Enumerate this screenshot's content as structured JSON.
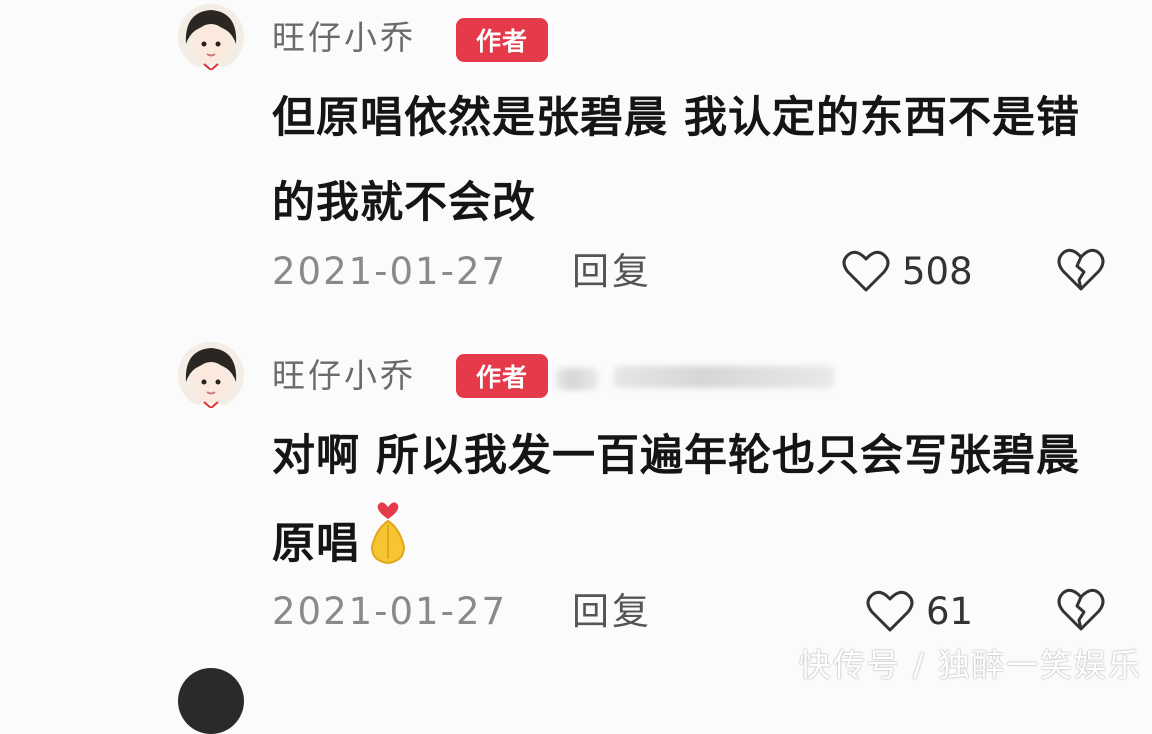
{
  "comments": [
    {
      "username": "旺仔小乔",
      "badge": "作者",
      "content": "但原唱依然是张碧晨 我认定的东西不是错的我就不会改",
      "date": "2021-01-27",
      "reply_label": "回复",
      "likes": "508"
    },
    {
      "username": "旺仔小乔",
      "badge": "作者",
      "content": "对啊 所以我发一百遍年轮也只会写张碧晨原唱",
      "emoji": "pray-hands-emoji",
      "date": "2021-01-27",
      "reply_label": "回复",
      "likes": "61"
    }
  ],
  "watermark": "快传号 / 独醉一笑娱乐",
  "icons": {
    "like": "heart-outline-icon",
    "dislike": "broken-heart-icon"
  },
  "colors": {
    "badge": "#e53a4a",
    "text_secondary": "#8a8a8a"
  }
}
